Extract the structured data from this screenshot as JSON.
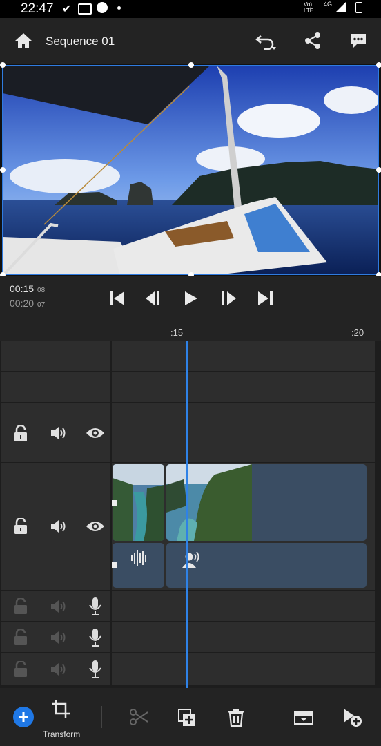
{
  "status_bar": {
    "time": "22:47",
    "network": "4G",
    "volte": "Vo) LTE"
  },
  "app_bar": {
    "title": "Sequence 01"
  },
  "transport": {
    "current_time": "00:15",
    "current_frames": "08",
    "duration": "00:20",
    "duration_frames": "07"
  },
  "ruler": {
    "marks": [
      ":15",
      ":20"
    ]
  },
  "toolbar": {
    "transform_label": "Transform"
  },
  "colors": {
    "accent": "#2f82e6",
    "clip": "#3a4d63",
    "track": "#2d2d2d",
    "background": "#1d1d1d"
  },
  "icons": [
    "home-icon",
    "undo-icon",
    "share-icon",
    "comment-icon",
    "skip-start-icon",
    "step-back-icon",
    "play-icon",
    "step-forward-icon",
    "skip-end-icon",
    "lock-icon",
    "volume-icon",
    "eye-icon",
    "mic-icon",
    "add-icon",
    "crop-icon",
    "scissors-icon",
    "duplicate-icon",
    "trash-icon",
    "slip-icon",
    "add-clip-icon"
  ]
}
